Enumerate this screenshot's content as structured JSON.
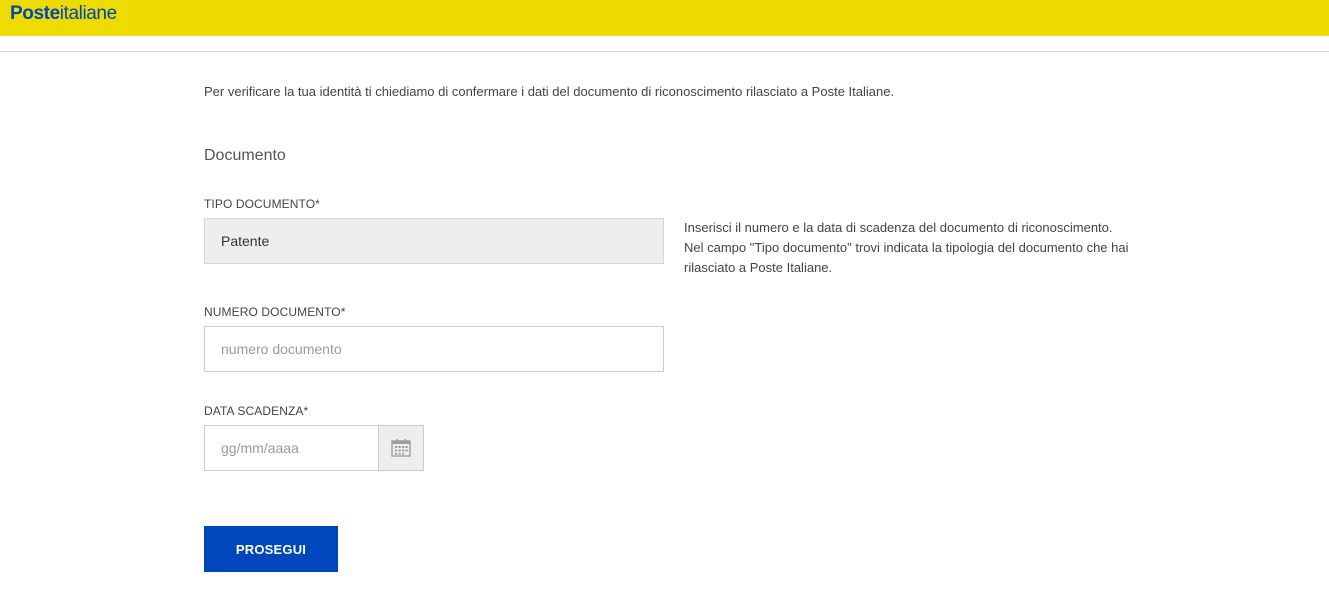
{
  "header": {
    "logo_bold": "Poste",
    "logo_regular": "italiane",
    "brand_color": "#eedc00",
    "logo_color": "#0047bb"
  },
  "intro_text": "Per verificare la tua identità ti chiediamo di confermare i dati del documento di riconoscimento rilasciato a Poste Italiane.",
  "section_title": "Documento",
  "form": {
    "tipo_documento": {
      "label": "TIPO DOCUMENTO*",
      "value": "Patente"
    },
    "numero_documento": {
      "label": "NUMERO DOCUMENTO*",
      "value": "",
      "placeholder": "numero documento"
    },
    "data_scadenza": {
      "label": "DATA SCADENZA*",
      "value": "",
      "placeholder": "gg/mm/aaaa",
      "icon": "calendar-icon"
    }
  },
  "help": {
    "line1": "Inserisci il numero e la data di scadenza del documento di riconoscimento.",
    "line2": "Nel campo \"Tipo documento\" trovi indicata la tipologia del documento che hai rilasciato a Poste Italiane."
  },
  "submit_label": "PROSEGUI",
  "button_color": "#0047bb"
}
